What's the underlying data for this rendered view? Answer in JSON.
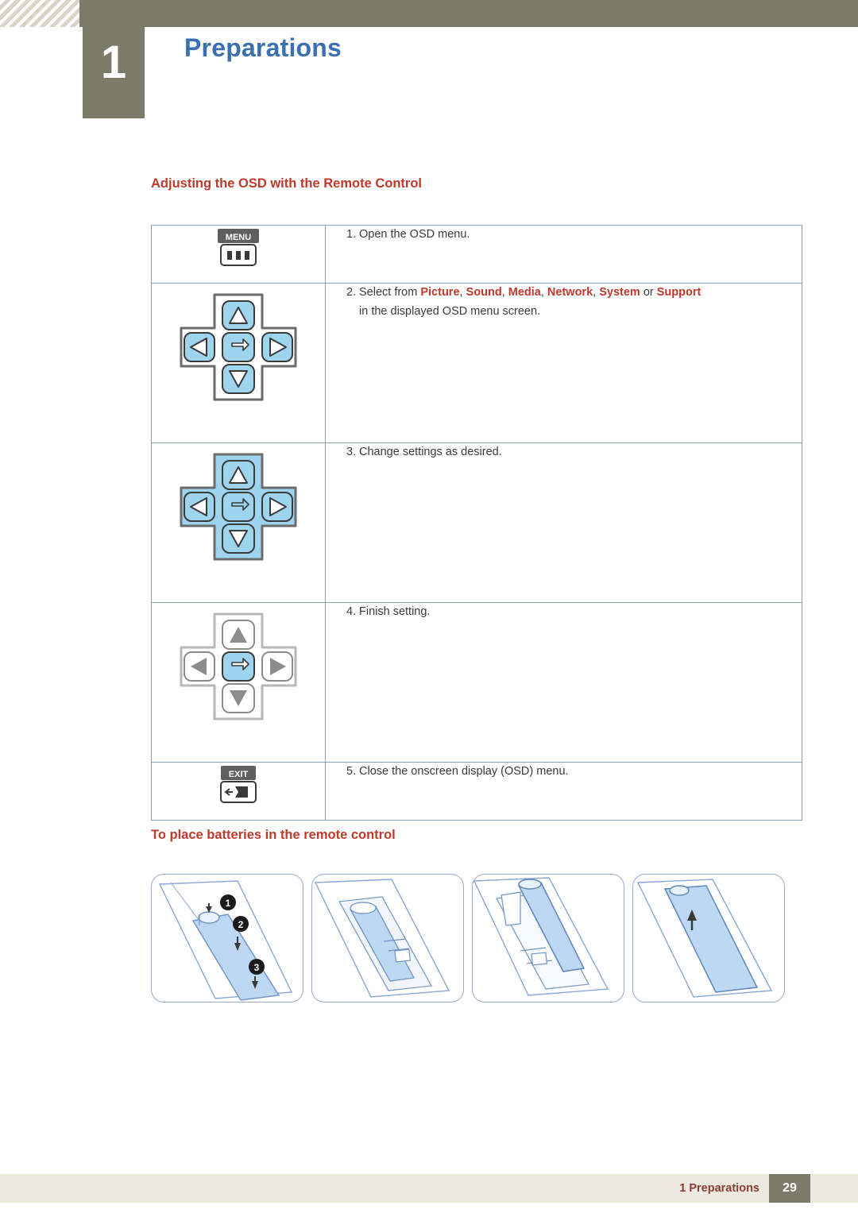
{
  "header": {
    "chapter_number": "1",
    "chapter_title": "Preparations"
  },
  "sections": {
    "osd_heading": "Adjusting the OSD with the Remote Control",
    "batteries_heading": "To place batteries in the remote control"
  },
  "osd_steps": [
    {
      "number": "1.",
      "text": "Open the OSD menu.",
      "icon": "menu-button-icon",
      "icon_label": "MENU"
    },
    {
      "number": "2.",
      "text_prefix": "Select from ",
      "options": [
        "Picture",
        "Sound",
        "Media",
        "Network",
        "System"
      ],
      "conjunction": " or ",
      "last_option": "Support",
      "text_suffix": "in the displayed OSD menu screen.",
      "icon": "dpad-directions-icon"
    },
    {
      "number": "3.",
      "text": "Change settings as desired.",
      "icon": "dpad-all-highlighted-icon"
    },
    {
      "number": "4.",
      "text": "Finish setting.",
      "icon": "dpad-enter-icon"
    },
    {
      "number": "5.",
      "text": "Close the onscreen display (OSD) menu.",
      "icon": "exit-button-icon",
      "icon_label": "EXIT"
    }
  ],
  "battery_panels": [
    {
      "callouts": [
        "1",
        "2",
        "3"
      ]
    },
    {
      "callouts": []
    },
    {
      "callouts": []
    },
    {
      "callouts": []
    }
  ],
  "footer": {
    "label": "1 Preparations",
    "page": "29"
  },
  "colors": {
    "accent_red": "#c0392b",
    "title_blue": "#3a6fb0",
    "band_olive": "#7c7a68",
    "highlight_blue": "#9fd4ef",
    "panel_border": "#9aa8d0"
  }
}
